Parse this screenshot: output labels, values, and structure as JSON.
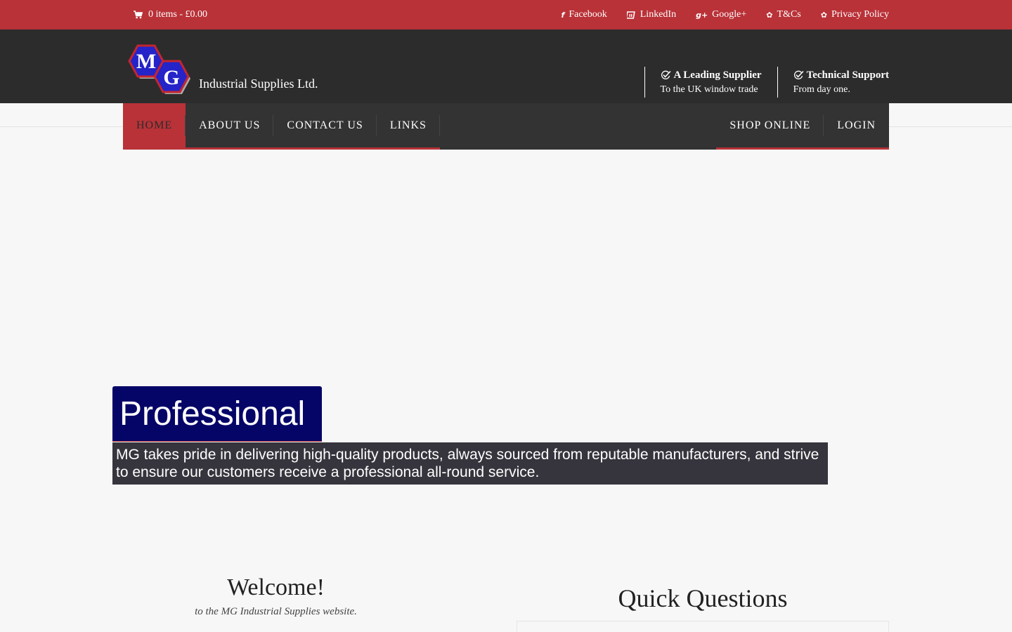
{
  "topbar": {
    "cart_text": "0 items - £0.00",
    "links": [
      {
        "label": "Facebook",
        "icon": "facebook-icon"
      },
      {
        "label": "LinkedIn",
        "icon": "linkedin-icon"
      },
      {
        "label": "Google+",
        "icon": "google-plus-icon"
      },
      {
        "label": "T&Cs",
        "icon": "gear-icon"
      },
      {
        "label": "Privacy Policy",
        "icon": "gear-icon"
      }
    ]
  },
  "header": {
    "logo_letters": [
      "M",
      "G"
    ],
    "logo_text": "Industrial Supplies Ltd.",
    "features": [
      {
        "title": "A Leading Supplier",
        "subtitle": "To the UK window trade"
      },
      {
        "title": "Technical Support",
        "subtitle": "From day one."
      }
    ]
  },
  "nav": {
    "left": [
      "HOME",
      "ABOUT US",
      "CONTACT US",
      "LINKS"
    ],
    "right": [
      "SHOP ONLINE",
      "LOGIN"
    ],
    "active": "HOME"
  },
  "hero": {
    "title": "Professional",
    "text": "MG takes pride in delivering high-quality products, always sourced from reputable manufacturers, and strive to ensure our customers receive a professional all-round service."
  },
  "welcome": {
    "title": "Welcome!",
    "subtitle": "to the MG Industrial Supplies website."
  },
  "quick_questions": {
    "title": "Quick Questions"
  },
  "colors": {
    "brand_red": "#b93238",
    "header_dark": "#2c2c2c",
    "nav_dark": "#333333",
    "hero_blue": "#050568",
    "hero_text_bg": "#36353d"
  }
}
